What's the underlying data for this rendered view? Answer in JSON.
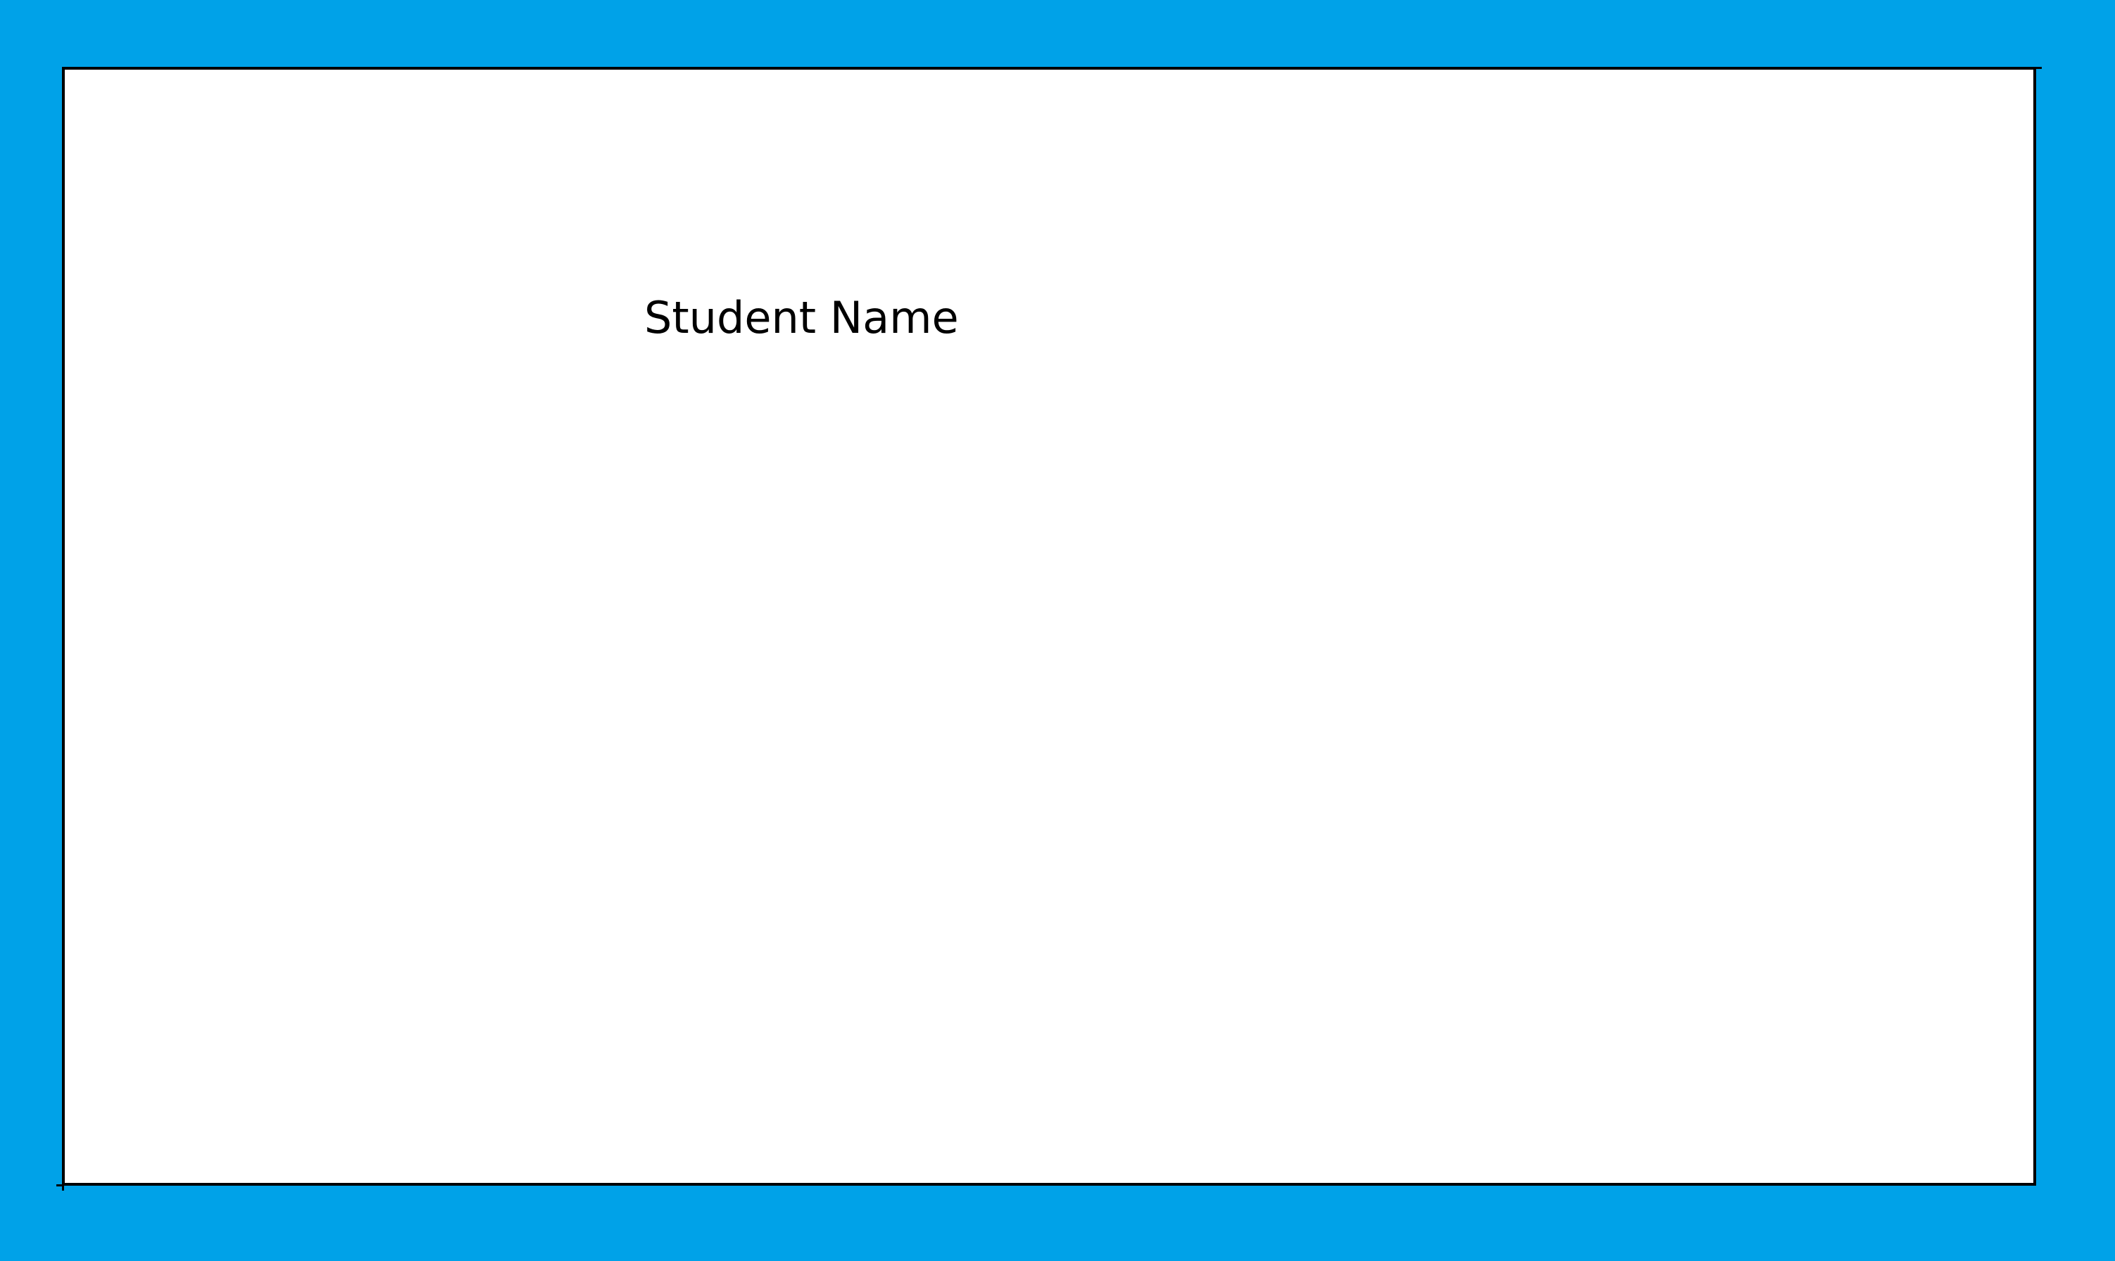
{
  "colors": {
    "background": "#00A2E8",
    "card": "#FFFFFF",
    "border": "#000000",
    "text": "#000000"
  },
  "card": {
    "student_name_label": "Student Name"
  }
}
